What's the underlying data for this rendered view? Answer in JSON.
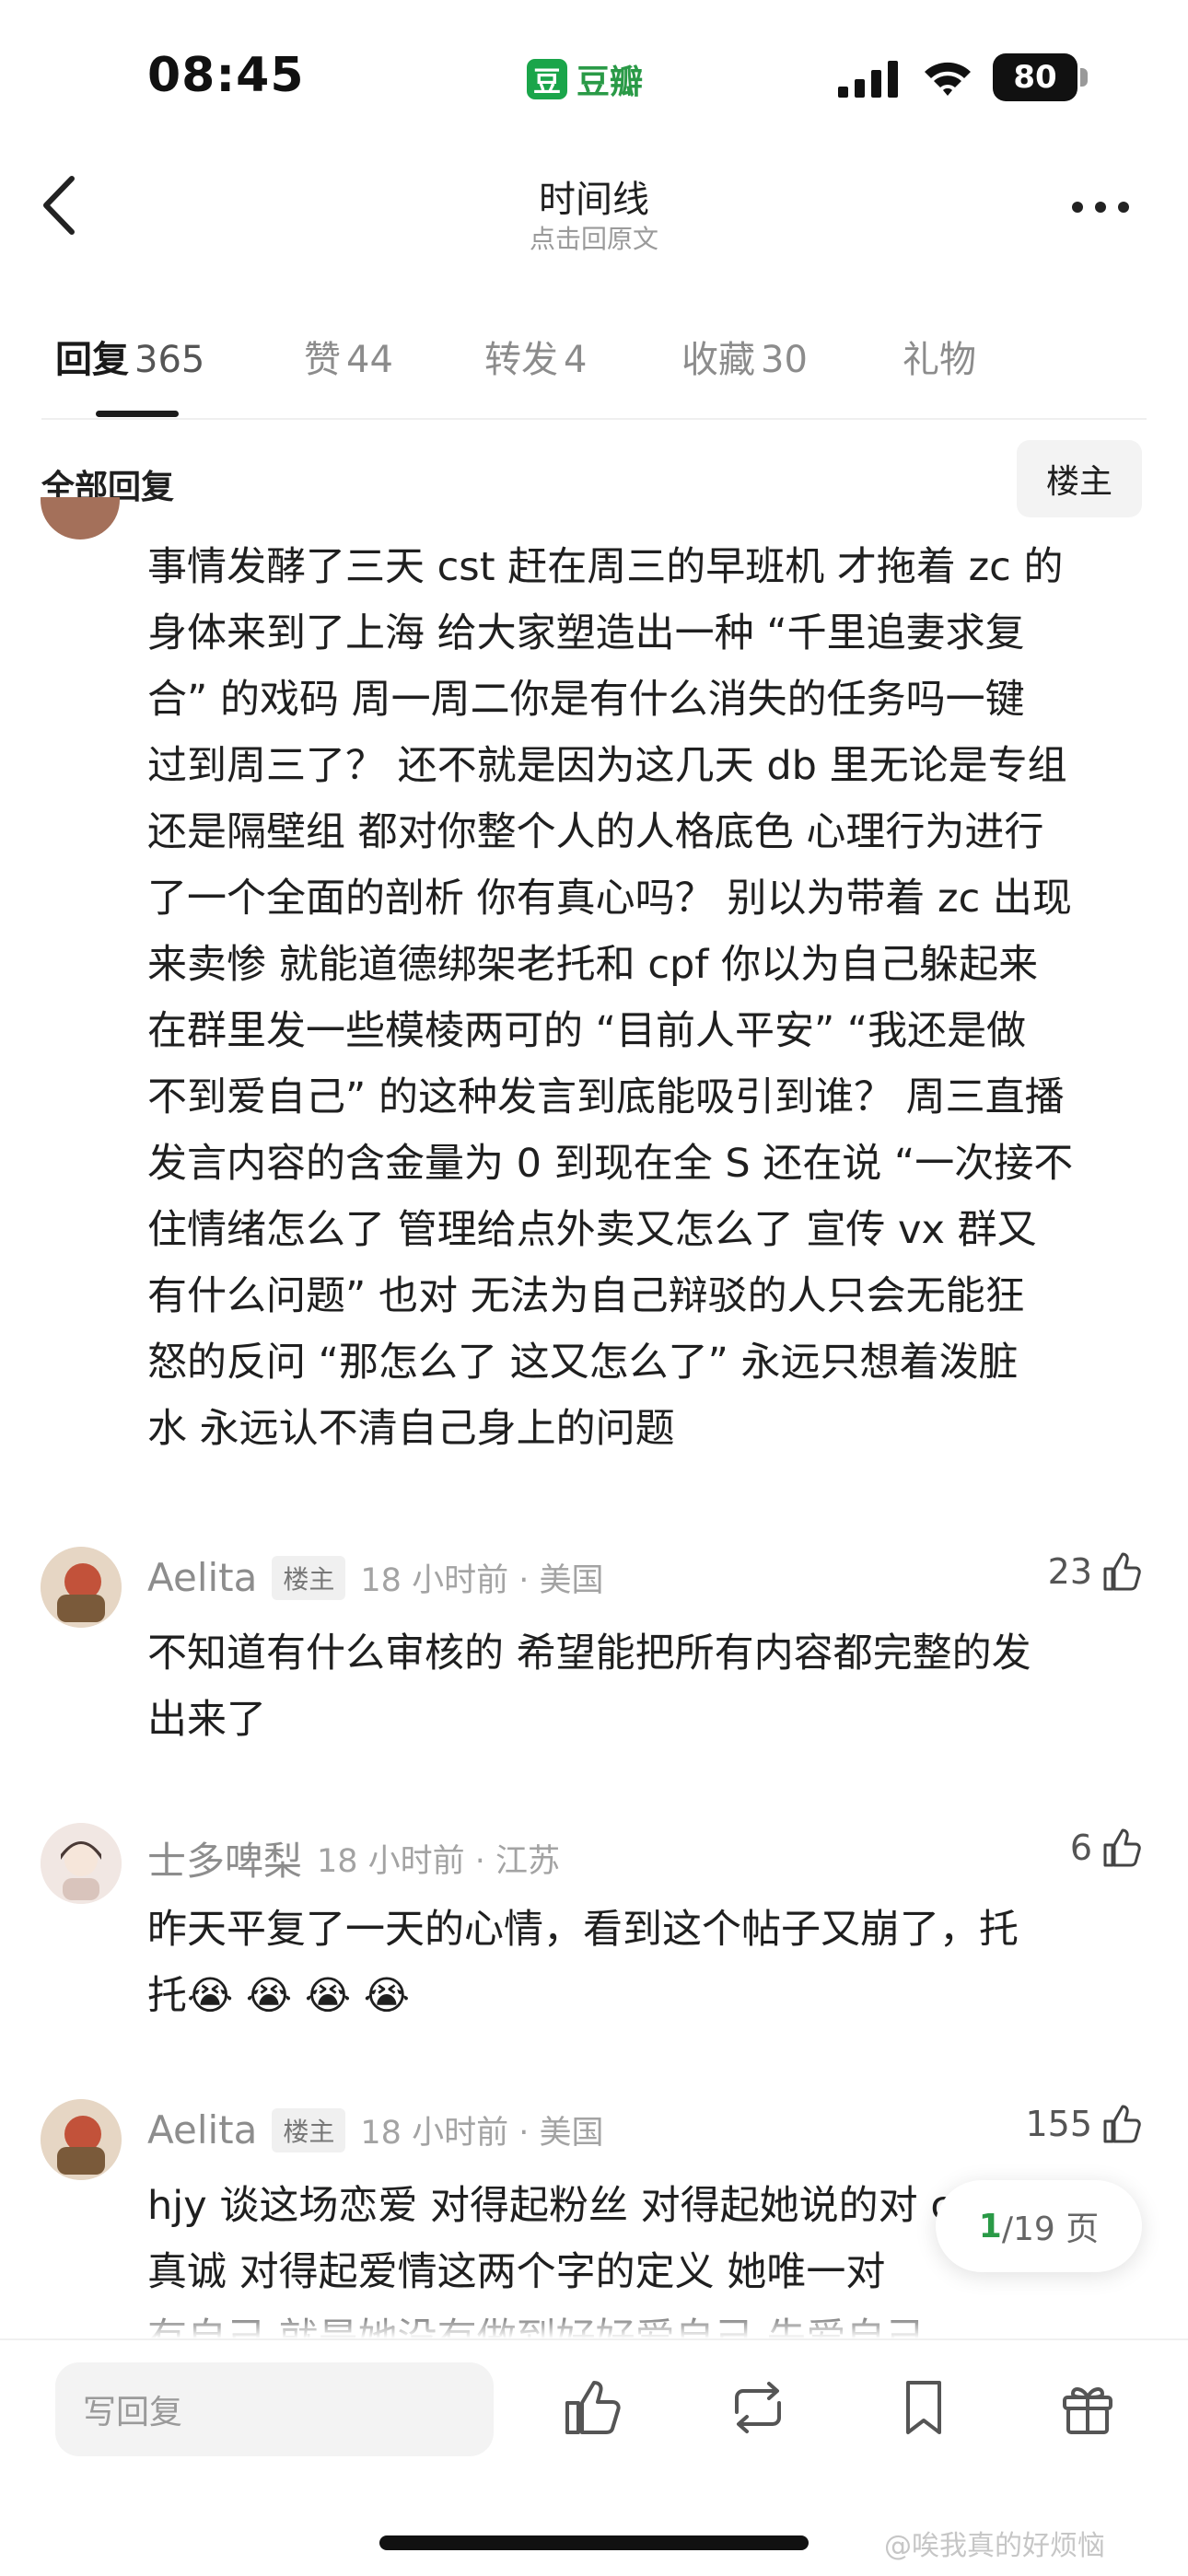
{
  "status": {
    "time": "08:45",
    "app_name": "豆瓣",
    "app_icon": "豆",
    "battery": "80"
  },
  "nav": {
    "title": "时间线",
    "subtitle": "点击回原文"
  },
  "tabs": [
    {
      "label": "回复",
      "count": "365"
    },
    {
      "label": "赞",
      "count": "44"
    },
    {
      "label": "转发",
      "count": "4"
    },
    {
      "label": "收藏",
      "count": "30"
    },
    {
      "label": "礼物",
      "count": ""
    }
  ],
  "filter": {
    "all_label": "全部回复",
    "op_label": "楼主"
  },
  "main_post": {
    "text": "事情发酵了三天 cst 赶在周三的早班机 才拖着 zc 的\n身体来到了上海 给大家塑造出一种 “千里追妻求复\n合” 的戏码 周一周二你是有什么消失的任务吗一键\n过到周三了？ 还不就是因为这几天 db 里无论是专组\n还是隔壁组 都对你整个人的人格底色 心理行为进行\n了一个全面的剖析 你有真心吗？ 别以为带着 zc 出现\n来卖惨 就能道德绑架老托和 cpf 你以为自己躲起来\n在群里发一些模棱两可的 “目前人平安” “我还是做\n不到爱自己” 的这种发言到底能吸引到谁？ 周三直播\n发言内容的含金量为 0 到现在全 S 还在说 “一次接不\n住情绪怎么了 管理给点外卖又怎么了 宣传 vx 群又\n有什么问题” 也对 无法为自己辩驳的人只会无能狂\n怒的反问 “那怎么了 这又怎么了” 永远只想着泼脏\n水 永远认不清自己身上的问题"
  },
  "comments": [
    {
      "name": "Aelita",
      "op_badge": "楼主",
      "meta": "18 小时前 · 美国",
      "likes": "23",
      "text": "不知道有什么审核的 希望能把所有内容都完整的发\n出来了"
    },
    {
      "name": "士多啤梨",
      "op_badge": "",
      "meta": "18 小时前 · 江苏",
      "likes": "6",
      "text": "昨天平复了一天的心情，看到这个帖子又崩了，托\n托😭 😭 😭 😭"
    },
    {
      "name": "Aelita",
      "op_badge": "楼主",
      "meta": "18 小时前 · 美国",
      "likes": "155",
      "text": "hjy 谈这场恋爱 对得起粉丝 对得起她说的对 cst 永远\n真诚 对得起爱情这两个字的定义 她唯一对\n有自己 就是她没有做到好好爱自己 先爱自己"
    }
  ],
  "pager": {
    "current": "1",
    "total": "/19 页"
  },
  "bottom": {
    "reply_placeholder": "写回复",
    "watermark": "@唉我真的好烦恼"
  },
  "colors": {
    "brand_green": "#2a9a47",
    "text": "#1f1f1f",
    "muted": "#8d8d8d"
  }
}
